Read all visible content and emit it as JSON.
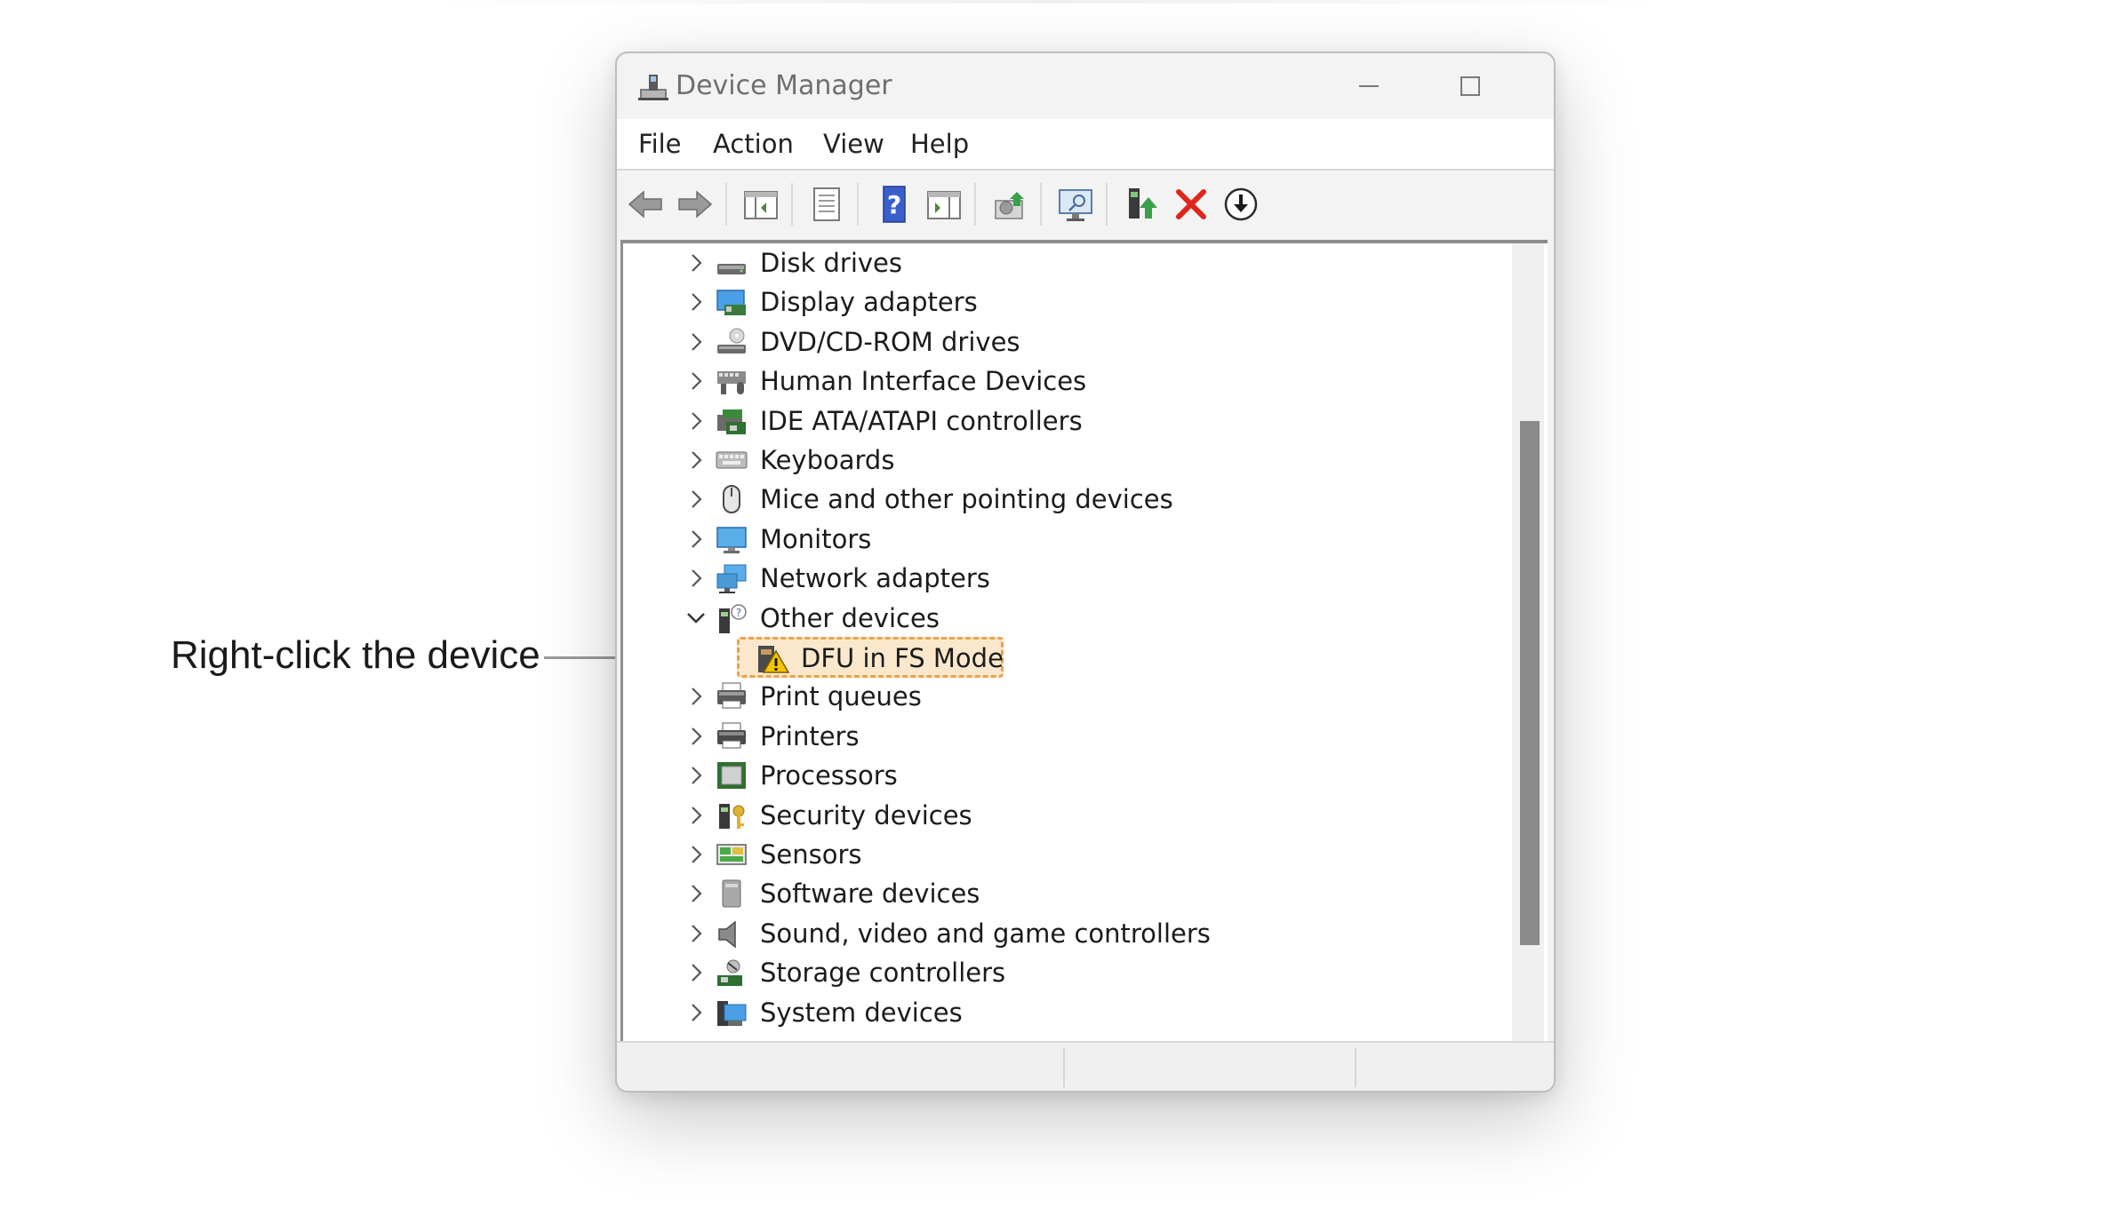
{
  "annotation": {
    "text": "Right-click the device"
  },
  "window": {
    "title": "Device Manager",
    "menu": [
      "File",
      "Action",
      "View",
      "Help"
    ]
  },
  "tree": {
    "items": [
      {
        "label": "Disk drives",
        "icon": "disk-drive-icon"
      },
      {
        "label": "Display adapters",
        "icon": "display-adapter-icon"
      },
      {
        "label": "DVD/CD-ROM drives",
        "icon": "dvd-drive-icon"
      },
      {
        "label": "Human Interface Devices",
        "icon": "hid-icon"
      },
      {
        "label": "IDE ATA/ATAPI controllers",
        "icon": "ide-controller-icon"
      },
      {
        "label": "Keyboards",
        "icon": "keyboard-icon"
      },
      {
        "label": "Mice and other pointing devices",
        "icon": "mouse-icon"
      },
      {
        "label": "Monitors",
        "icon": "monitor-icon"
      },
      {
        "label": "Network adapters",
        "icon": "network-adapter-icon"
      },
      {
        "label": "Other devices",
        "icon": "other-devices-icon",
        "expanded": true
      },
      {
        "label": "Print queues",
        "icon": "print-queue-icon"
      },
      {
        "label": "Printers",
        "icon": "printer-icon"
      },
      {
        "label": "Processors",
        "icon": "processor-icon"
      },
      {
        "label": "Security devices",
        "icon": "security-device-icon"
      },
      {
        "label": "Sensors",
        "icon": "sensor-icon"
      },
      {
        "label": "Software devices",
        "icon": "software-device-icon"
      },
      {
        "label": "Sound, video and game controllers",
        "icon": "sound-icon"
      },
      {
        "label": "Storage controllers",
        "icon": "storage-controller-icon"
      },
      {
        "label": "System devices",
        "icon": "system-device-icon"
      }
    ],
    "child": {
      "label": "DFU in FS Mode",
      "icon": "warning-device-icon"
    }
  },
  "colors": {
    "highlight_fill": "#fbe8cc",
    "highlight_border": "#f0a04a",
    "delete_red": "#e0261c",
    "help_blue": "#3a5fcd"
  }
}
